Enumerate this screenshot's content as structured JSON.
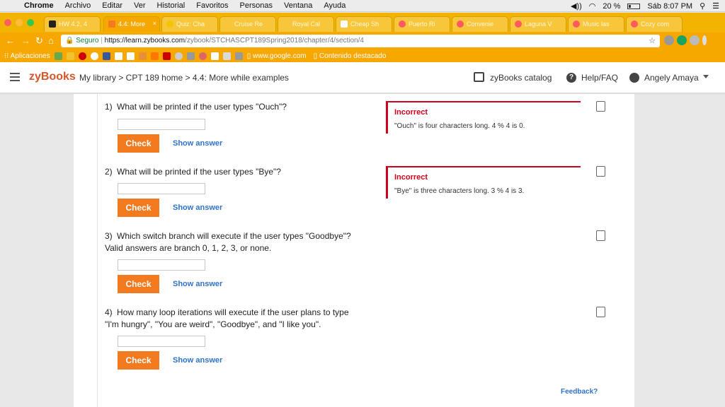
{
  "menubar": {
    "app": "Chrome",
    "items": [
      "Archivo",
      "Editar",
      "Ver",
      "Historial",
      "Favoritos",
      "Personas",
      "Ventana",
      "Ayuda"
    ],
    "battery": "20 %",
    "clock": "Sáb 8:07 PM"
  },
  "tabs": [
    {
      "label": "HW 4.2, 4",
      "color": "#222222"
    },
    {
      "label": "4.4: More",
      "color": "#f37a1f"
    },
    {
      "label": "Quiz: Cha",
      "color": "#f2c500"
    },
    {
      "label": "Cruise Re",
      "color": "#f7c63a"
    },
    {
      "label": "Royal Cal",
      "color": "#e85a4f"
    },
    {
      "label": "Cheap Sh",
      "color": "#f2c500"
    },
    {
      "label": "Puerto Ri",
      "color": "#ff5a5f"
    },
    {
      "label": "Convenie",
      "color": "#ff5a5f"
    },
    {
      "label": "Laguna V",
      "color": "#ff5a5f"
    },
    {
      "label": "Music las",
      "color": "#ff5a5f"
    },
    {
      "label": "Cozy com",
      "color": "#ff5a5f"
    }
  ],
  "address": {
    "secure_label": "Seguro",
    "url_host": "https://learn.zybooks.com",
    "url_path": "/zybook/STCHASCPT189Spring2018/chapter/4/section/4"
  },
  "bookmarks": {
    "apps_label": "Aplicaciones",
    "google": "www.google.com",
    "featured": "Contenido destacado"
  },
  "header": {
    "logo": "zyBooks",
    "breadcrumb": "My library > CPT 189 home > 4.4: More while examples",
    "catalog": "zyBooks catalog",
    "help": "Help/FAQ",
    "user": "Angely Amaya"
  },
  "questions": [
    {
      "number": "1)",
      "text": "What will be printed if the user types \"Ouch\"?",
      "value": "",
      "check": "Check",
      "show": "Show answer",
      "feedback": {
        "title": "Incorrect",
        "text": "\"Ouch\" is four characters long. 4 % 4 is 0."
      }
    },
    {
      "number": "2)",
      "text": "What will be printed if the user types \"Bye\"?",
      "value": "",
      "check": "Check",
      "show": "Show answer",
      "feedback": {
        "title": "Incorrect",
        "text": "\"Bye\" is three characters long. 3 % 4 is 3."
      }
    },
    {
      "number": "3)",
      "text": "Which switch branch will execute if the user types \"Goodbye\"? Valid answers are branch 0, 1, 2, 3, or none.",
      "value": "",
      "check": "Check",
      "show": "Show answer"
    },
    {
      "number": "4)",
      "text": "How many loop iterations will execute if the user plans to type \"I'm hungry\", \"You are weird\", \"Goodbye\", and \"I like you\".",
      "value": "",
      "check": "Check",
      "show": "Show answer"
    }
  ],
  "feedback_link": "Feedback?",
  "colors": {
    "accent": "#f37a1f",
    "incorrect": "#d0021b",
    "link": "#2f73c9",
    "chrome_tab": "#f6a800"
  }
}
